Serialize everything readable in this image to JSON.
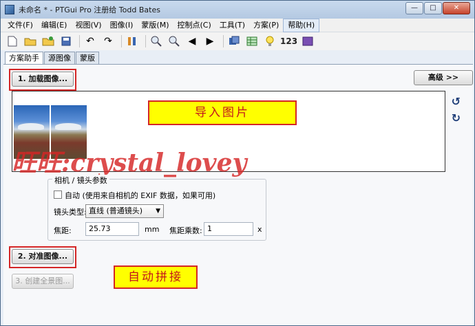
{
  "window": {
    "title": "未命名 * - PTGui Pro 注册给 Todd Bates"
  },
  "menu": [
    "文件(F)",
    "编辑(E)",
    "视图(V)",
    "图像(I)",
    "蒙版(M)",
    "控制点(C)",
    "工具(T)",
    "方案(P)",
    "帮助(H)"
  ],
  "toolbar": {
    "number_label": "123"
  },
  "tabs": [
    "方案助手",
    "源图像",
    "蒙版"
  ],
  "step1": {
    "load_button": "1. 加载图像...",
    "advanced_button": "高级 >>"
  },
  "annotations": {
    "import_note": "导入图片",
    "auto_stitch_note": "自动拼接",
    "watermark": "旺旺:crystal_lovey"
  },
  "camera": {
    "group_title": "相机 / 镜头参数",
    "auto_label": "自动 (使用来自相机的 EXIF 数据，如果可用)",
    "lens_type_label": "镜头类型:",
    "lens_type_value": "直线 (普通镜头)",
    "focal_label": "焦距:",
    "focal_value": "25.73",
    "focal_unit": "mm",
    "multiplier_label": "焦距乘数:",
    "multiplier_value": "1",
    "multiplier_unit": "x"
  },
  "step2": {
    "align_button": "2. 对准图像..."
  },
  "step3": {
    "create_button": "3. 创建全景图..."
  },
  "colors": {
    "annotation_red": "#d42626",
    "note_yellow": "#ffff00"
  }
}
